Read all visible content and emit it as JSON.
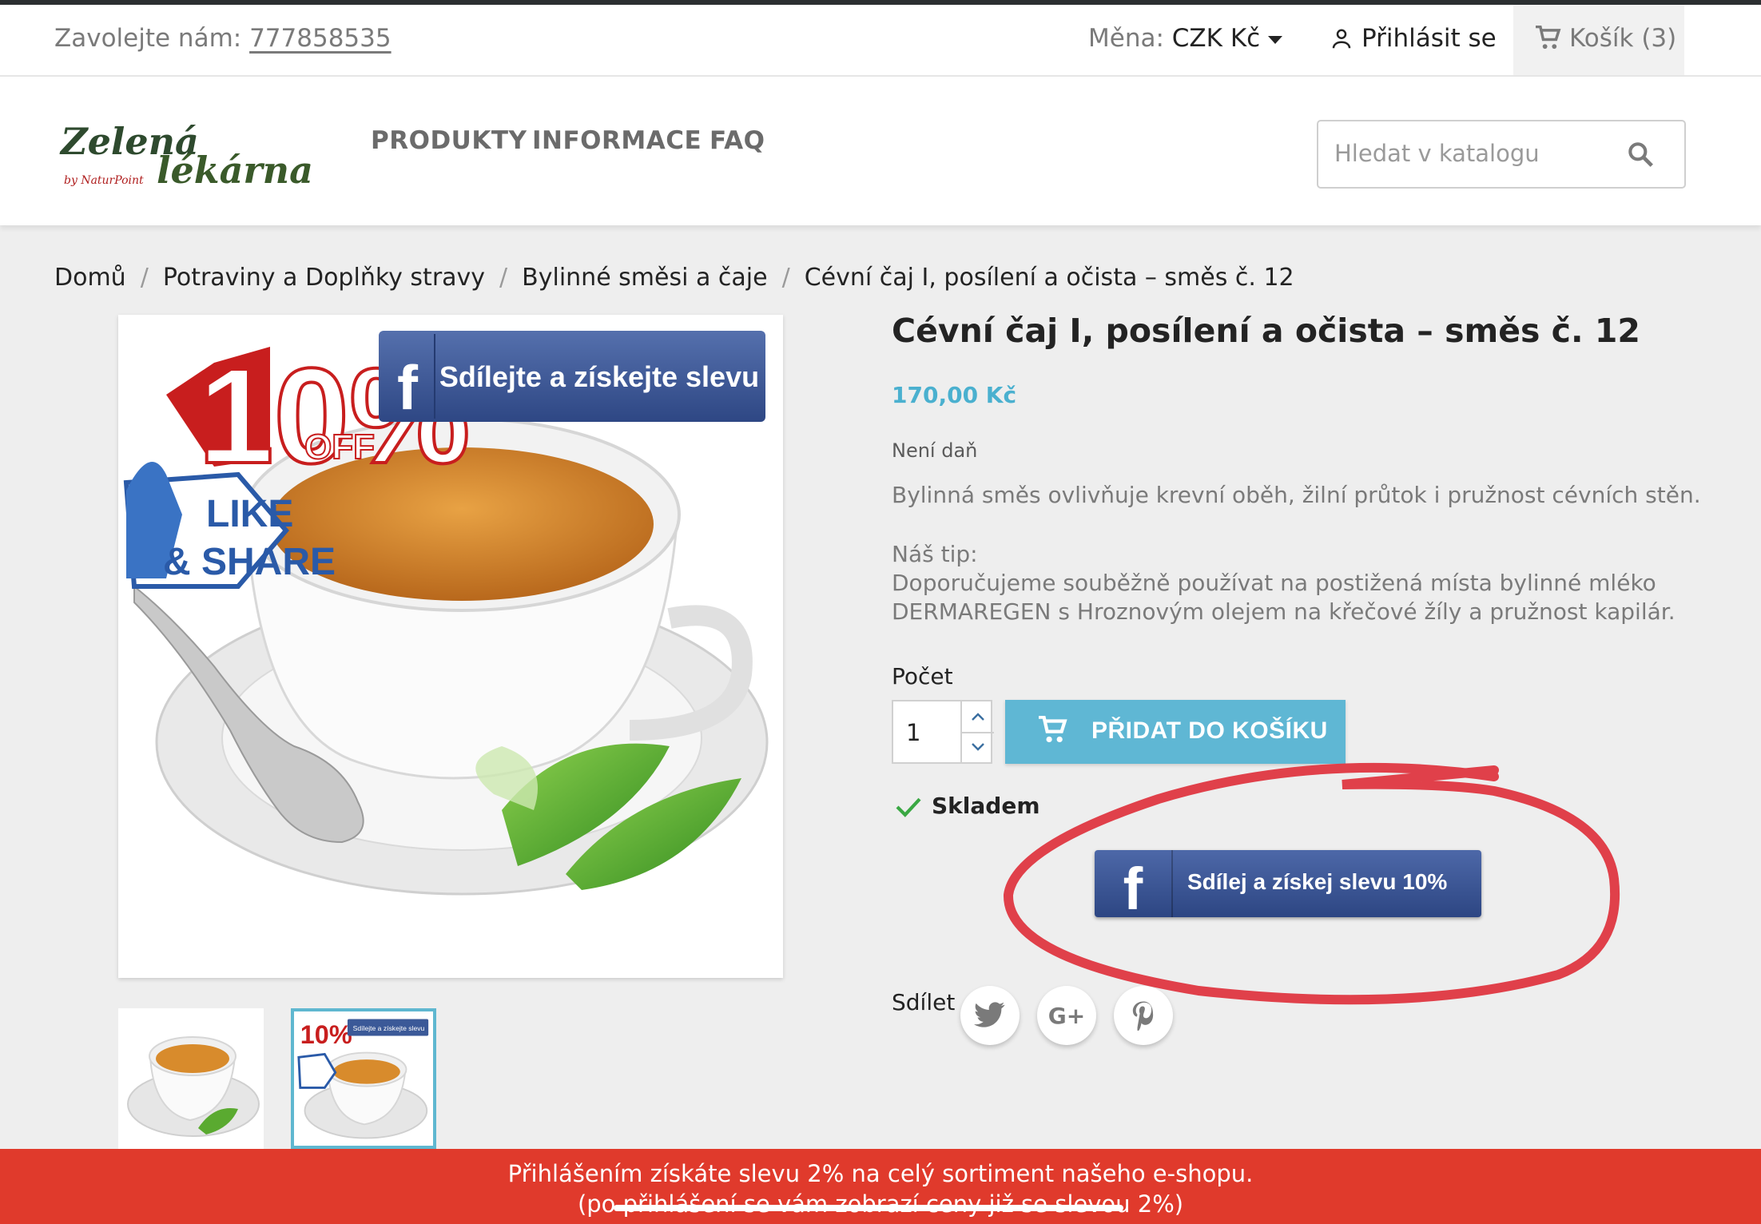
{
  "topbar": {
    "call_label": "Zavolejte nám:",
    "phone": "777858535",
    "currency_label": "Měna:",
    "currency_value": "CZK Kč",
    "login": "Přihlásit se",
    "cart": "Košík (3)"
  },
  "logo": {
    "line1": "Zelená",
    "line2": "lékárna",
    "line3": "by NaturPoint"
  },
  "nav": [
    "PRODUKTY",
    "INFORMACE",
    "FAQ"
  ],
  "search": {
    "placeholder": "Hledat v katalogu"
  },
  "breadcrumb": [
    "Domů",
    "Potraviny a Doplňky stravy",
    "Bylinné směsi a čaje",
    "Cévní čaj I, posílení a očista – směs č. 12"
  ],
  "product": {
    "title": "Cévní čaj I, posílení a očista – směs č. 12",
    "price": "170,00 Kč",
    "tax": "Není daň",
    "description": "Bylinná směs ovlivňuje krevní oběh, žilní průtok i pružnost cévních stěn.",
    "tip_label": "Náš tip:",
    "tip_line1": "Doporučujeme souběžně používat na postižená místa bylinné mléko",
    "tip_line2": "DERMAREGEN s Hroznovým olejem na křečové žíly a pružnost kapilár.",
    "qty_label": "Počet",
    "qty_value": "1",
    "add_to_cart": "PŘIDAT DO KOŠÍKU",
    "stock": "Skladem",
    "fb_button": "Sdílej a získej slevu 10%",
    "share_label": "Sdílet"
  },
  "image_banner": {
    "fb_text": "Sdílejte a získejte slevu",
    "percent": "10%",
    "off": "OFF",
    "like": "LIKE",
    "share": "& SHARE"
  },
  "thumb_banner": {
    "fb_text": "Sdílejte a získejte slevu",
    "percent": "10%"
  },
  "social": [
    "twitter-icon",
    "google-plus-icon",
    "pinterest-icon"
  ],
  "promo": {
    "line1": "Přihlášením získáte slevu 2% na celý sortiment našeho e-shopu.",
    "line2": "(po přihlášení se vám zobrazí ceny již se slevou 2%)"
  },
  "colors": {
    "accent": "#5fb7d4",
    "price": "#4ab0cf",
    "promo": "#e03a2c",
    "facebook": "#3b5998",
    "highlight": "#e0404a"
  }
}
